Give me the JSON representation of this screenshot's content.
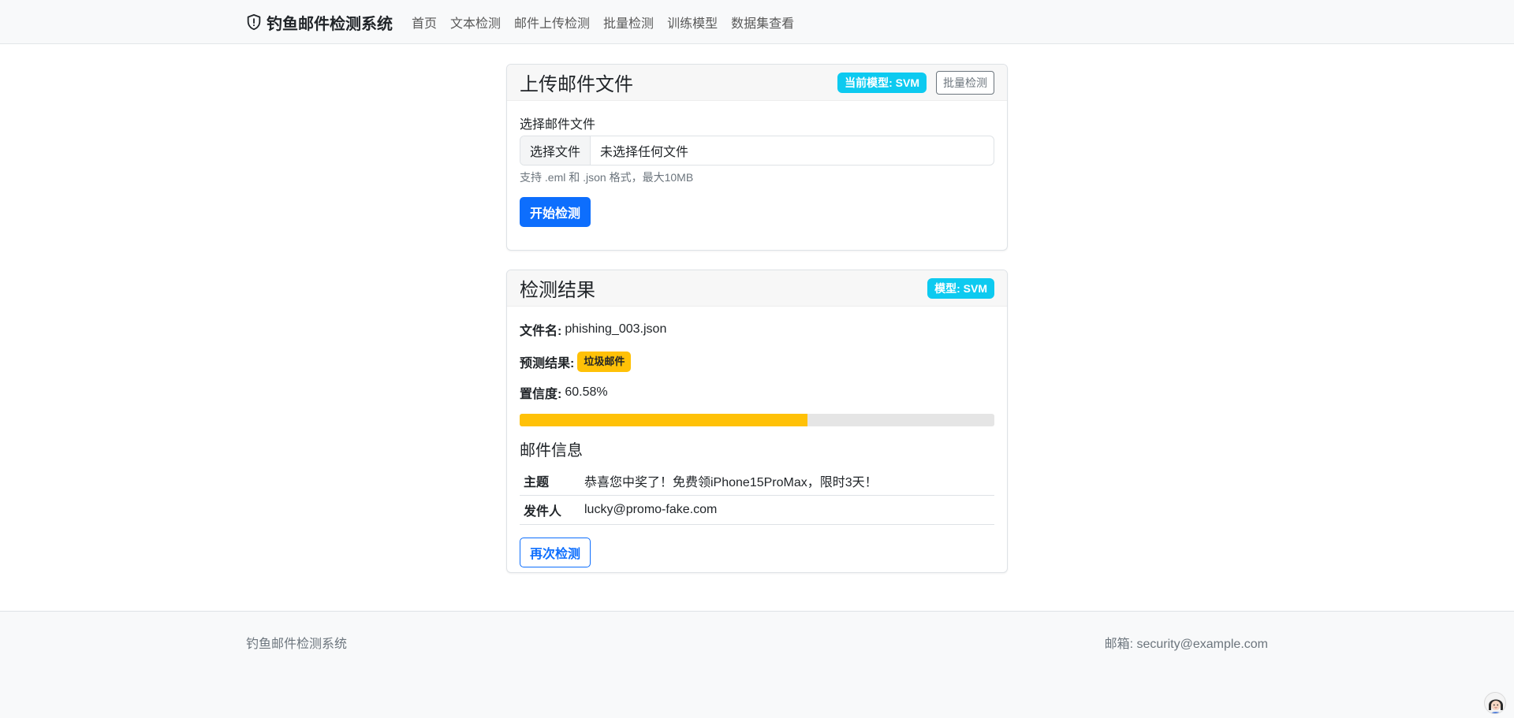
{
  "navbar": {
    "brand_icon": "shield-exclamation-icon",
    "brand": "钓鱼邮件检测系统",
    "links": [
      "首页",
      "文本检测",
      "邮件上传检测",
      "批量检测",
      "训练模型",
      "数据集查看"
    ]
  },
  "upload_card": {
    "title": "上传邮件文件",
    "model_badge": "当前模型: SVM",
    "batch_button": "批量检测",
    "file_label": "选择邮件文件",
    "file_button": "选择文件",
    "file_status": "未选择任何文件",
    "help_text": "支持 .eml 和 .json 格式，最大10MB",
    "submit_button": "开始检测"
  },
  "result_card": {
    "title": "检测结果",
    "model_badge": "模型: SVM",
    "filename_label": "文件名:",
    "filename": "phishing_003.json",
    "prediction_label": "预测结果:",
    "prediction": "垃圾邮件",
    "confidence_label": "置信度:",
    "confidence": "60.58%",
    "confidence_fraction": 0.6058,
    "info_title": "邮件信息",
    "info_rows": [
      {
        "key": "主题",
        "value": "恭喜您中奖了！免费领iPhone15ProMax，限时3天！"
      },
      {
        "key": "发件人",
        "value": "lucky@promo-fake.com"
      }
    ],
    "retry_button": "再次检测"
  },
  "footer": {
    "left": "钓鱼邮件检测系统",
    "right": "邮箱: security@example.com"
  },
  "colors": {
    "primary": "#0d6efd",
    "info": "#0dcaf0",
    "warning": "#ffc107"
  }
}
